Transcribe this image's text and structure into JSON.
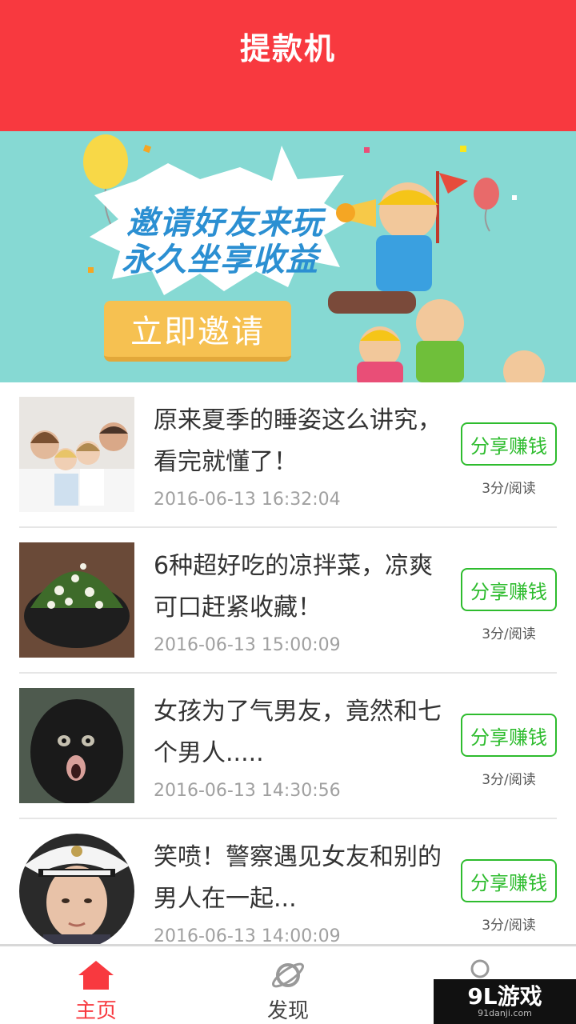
{
  "header": {
    "title": "提款机"
  },
  "banner": {
    "line1": "邀请好友来玩",
    "line2": "永久坐享收益",
    "button_label": "立即邀请"
  },
  "articles": [
    {
      "title": "原来夏季的睡姿这么讲究，看完就懂了！",
      "date": "2016-06-13 16:32:04",
      "share_label": "分享赚钱",
      "reward": "3分/阅读",
      "thumb": "family-sleeping-image"
    },
    {
      "title": "6种超好吃的凉拌菜，凉爽可口赶紧收藏！",
      "date": "2016-06-13 15:00:09",
      "share_label": "分享赚钱",
      "reward": "3分/阅读",
      "thumb": "salad-bowl-image"
    },
    {
      "title": "女孩为了气男友，竟然和七个男人.....",
      "date": "2016-06-13 14:30:56",
      "share_label": "分享赚钱",
      "reward": "3分/阅读",
      "thumb": "monkey-image"
    },
    {
      "title": "笑喷！警察遇见女友和别的男人在一起...",
      "date": "2016-06-13 14:00:09",
      "share_label": "分享赚钱",
      "reward": "3分/阅读",
      "thumb": "police-woman-image"
    }
  ],
  "tabs": [
    {
      "label": "主页",
      "icon": "home-icon",
      "active": true
    },
    {
      "label": "发现",
      "icon": "planet-icon",
      "active": false
    },
    {
      "label": "",
      "icon": "user-icon",
      "active": false
    }
  ],
  "watermark": {
    "main": "9L游戏",
    "sub": "91danji.com"
  },
  "colors": {
    "brand_red": "#f8393f",
    "share_green": "#2ebc2e",
    "banner_teal": "#86d9d3"
  }
}
